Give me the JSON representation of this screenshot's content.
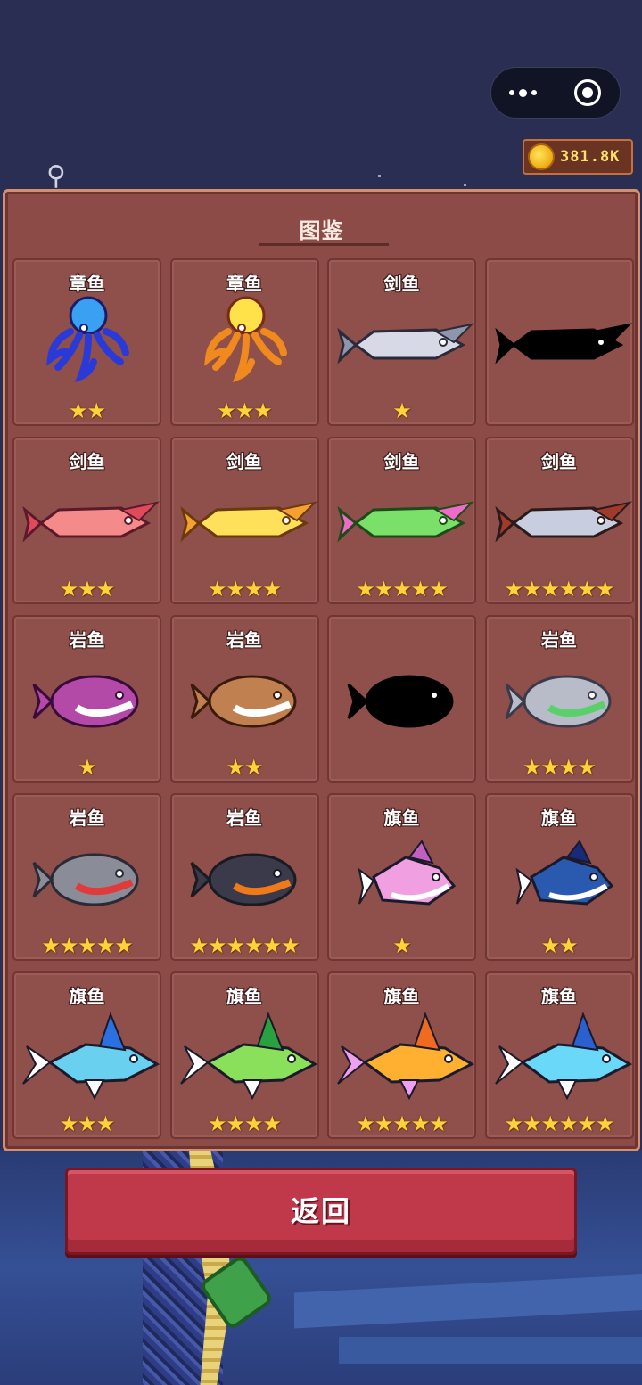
{
  "top_bar": {
    "coins": "381.8K",
    "coin_icon": "gold-coin-icon",
    "more_icon": "more-dots-icon",
    "close_icon": "target-circle-icon"
  },
  "panel": {
    "title": "图鉴"
  },
  "fish": [
    {
      "name": "章鱼",
      "stars": "★★",
      "kind": "octopus",
      "colors": [
        "#3aa0f2",
        "#2a3ad8",
        "#1b1b6e"
      ],
      "discovered": true
    },
    {
      "name": "章鱼",
      "stars": "★★★",
      "kind": "octopus",
      "colors": [
        "#ffe24a",
        "#f08a1e",
        "#7a2a10"
      ],
      "discovered": true
    },
    {
      "name": "剑鱼",
      "stars": "★",
      "kind": "sword",
      "colors": [
        "#d7dae6",
        "#8f95aa",
        "#2a2a3a"
      ],
      "discovered": true
    },
    {
      "name": "",
      "stars": "",
      "kind": "sword",
      "colors": [
        "#000000",
        "#000000",
        "#000000"
      ],
      "discovered": false
    },
    {
      "name": "剑鱼",
      "stars": "★★★",
      "kind": "sword",
      "colors": [
        "#f58a8a",
        "#e04a5a",
        "#5a1a2a"
      ],
      "discovered": true
    },
    {
      "name": "剑鱼",
      "stars": "★★★★",
      "kind": "sword",
      "colors": [
        "#ffe05a",
        "#f6a030",
        "#6a3a0a"
      ],
      "discovered": true
    },
    {
      "name": "剑鱼",
      "stars": "★★★★★",
      "kind": "sword",
      "colors": [
        "#7ae06a",
        "#f06ac8",
        "#1e4a1a"
      ],
      "discovered": true
    },
    {
      "name": "剑鱼",
      "stars": "★★★★★★",
      "kind": "sword",
      "colors": [
        "#c8cee0",
        "#a03a2a",
        "#2a1a1a"
      ],
      "discovered": true
    },
    {
      "name": "岩鱼",
      "stars": "★",
      "kind": "rock",
      "colors": [
        "#b34aa8",
        "#ffffff",
        "#3a0a3a"
      ],
      "discovered": true
    },
    {
      "name": "岩鱼",
      "stars": "★★",
      "kind": "rock",
      "colors": [
        "#c08050",
        "#ffffff",
        "#3a1a0a"
      ],
      "discovered": true
    },
    {
      "name": "",
      "stars": "",
      "kind": "rock",
      "colors": [
        "#000000",
        "#000000",
        "#000000"
      ],
      "discovered": false
    },
    {
      "name": "岩鱼",
      "stars": "★★★★",
      "kind": "rock",
      "colors": [
        "#b8bcc8",
        "#5ad06a",
        "#3a3a4a"
      ],
      "discovered": true
    },
    {
      "name": "岩鱼",
      "stars": "★★★★★",
      "kind": "rock",
      "colors": [
        "#8a8c98",
        "#e03a3a",
        "#2a2a36"
      ],
      "discovered": true
    },
    {
      "name": "岩鱼",
      "stars": "★★★★★★",
      "kind": "rock",
      "colors": [
        "#3a3a4a",
        "#f07a1a",
        "#1a1a22"
      ],
      "discovered": true
    },
    {
      "name": "旗鱼",
      "stars": "★",
      "kind": "flag",
      "colors": [
        "#f0a0e0",
        "#c060c0",
        "#ffffff"
      ],
      "discovered": true
    },
    {
      "name": "旗鱼",
      "stars": "★★",
      "kind": "flag",
      "colors": [
        "#2a5ab0",
        "#1a2a7a",
        "#ffffff"
      ],
      "discovered": true
    },
    {
      "name": "旗鱼",
      "stars": "★★★",
      "kind": "marlin",
      "colors": [
        "#6ad0f0",
        "#2a70e0",
        "#ffffff"
      ],
      "discovered": true
    },
    {
      "name": "旗鱼",
      "stars": "★★★★",
      "kind": "marlin",
      "colors": [
        "#8ae05a",
        "#2aa040",
        "#ffffff"
      ],
      "discovered": true
    },
    {
      "name": "旗鱼",
      "stars": "★★★★★",
      "kind": "marlin",
      "colors": [
        "#ffb030",
        "#f06a20",
        "#f0a0f0"
      ],
      "discovered": true
    },
    {
      "name": "旗鱼",
      "stars": "★★★★★★",
      "kind": "marlin",
      "colors": [
        "#6ad8f8",
        "#2a60d0",
        "#ffffff"
      ],
      "discovered": true
    }
  ],
  "back_button": {
    "label": "返回"
  }
}
